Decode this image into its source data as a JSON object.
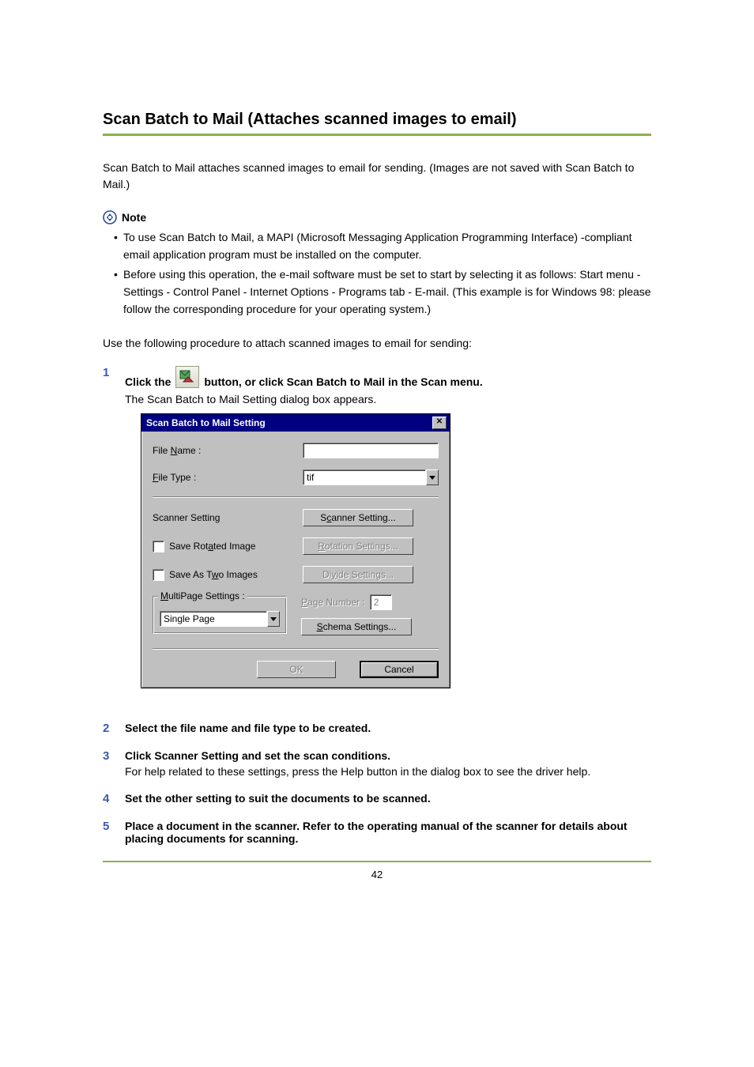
{
  "heading": "Scan Batch to Mail (Attaches scanned images to email)",
  "intro": "Scan Batch to Mail attaches scanned images to email for sending. (Images are not saved with Scan Batch to Mail.)",
  "note_label": "Note",
  "notes": [
    "To use Scan Batch to Mail, a MAPI (Microsoft Messaging Application Programming Interface) -compliant email application program must be installed on the computer.",
    "Before using this operation, the e-mail software must be set to start by selecting it as follows: Start menu -Settings - Control Panel - Internet Options - Programs tab - E-mail. (This example is for Windows 98: please follow the corresponding procedure for your operating system.)"
  ],
  "lead": "Use the following procedure to attach scanned images to email for sending:",
  "steps": {
    "1": {
      "pre": "Click the",
      "post": "button, or click Scan Batch to Mail in the Scan menu.",
      "sub": "The Scan Batch to Mail Setting dialog box appears."
    },
    "2": "Select the file name and file type to be created.",
    "3": {
      "main": "Click Scanner Setting and set the scan conditions.",
      "sub": "For help related to these settings, press the Help button in the dialog box to see the driver help."
    },
    "4": "Set the other setting to suit the documents to be scanned.",
    "5": "Place a document in the scanner. Refer to the operating manual of the scanner for details about placing documents for scanning."
  },
  "dialog": {
    "title": "Scan Batch to Mail Setting",
    "file_name_label_pre": "File ",
    "file_name_label_u": "N",
    "file_name_label_post": "ame :",
    "file_type_label_u": "F",
    "file_type_label_post": "ile Type :",
    "file_type_value": "tif",
    "scanner_setting_label": "Scanner Setting",
    "scanner_setting_btn_pre": "S",
    "scanner_setting_btn_u": "c",
    "scanner_setting_btn_post": "anner Setting...",
    "save_rotated_pre": "Save Rot",
    "save_rotated_u": "a",
    "save_rotated_post": "ted Image",
    "rotation_btn_u": "R",
    "rotation_btn_post": "otation Settings...",
    "save_two_pre": "Save As T",
    "save_two_u": "w",
    "save_two_post": "o Images",
    "divide_btn_pre": "Di",
    "divide_btn_u": "v",
    "divide_btn_post": "ide Settings...",
    "multipage_legend_u": "M",
    "multipage_legend_post": "ultiPage Settings :",
    "multipage_value": "Single Page",
    "page_number_label_u": "P",
    "page_number_label_post": "age Number :",
    "page_number_value": "2",
    "schema_btn_u": "S",
    "schema_btn_post": "chema Settings...",
    "ok": "OK",
    "cancel": "Cancel"
  },
  "page_number": "42"
}
